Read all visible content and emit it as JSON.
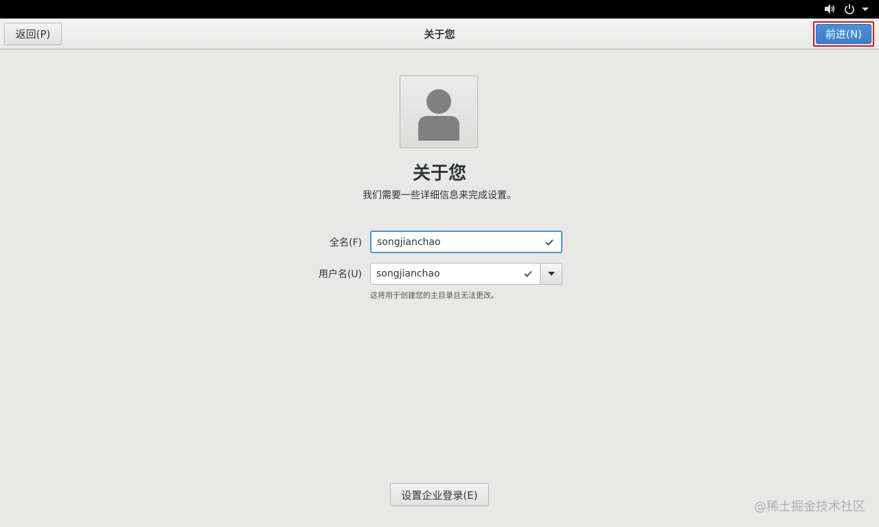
{
  "header": {
    "back_label": "返回(P)",
    "title": "关于您",
    "next_label": "前进(N)"
  },
  "main": {
    "title": "关于您",
    "subtitle": "我们需要一些详细信息来完成设置。",
    "fullname": {
      "label": "全名(F)",
      "value": "songjianchao"
    },
    "username": {
      "label": "用户名(U)",
      "value": "songjianchao",
      "hint": "这将用于创建您的主目录且无法更改。"
    },
    "enterprise_label": "设置企业登录(E)"
  },
  "watermark": "@稀土掘金技术社区",
  "colors": {
    "accent": "#4a90d9",
    "highlight": "#d6151f"
  },
  "icons": [
    "volume-icon",
    "power-icon",
    "chevron-down-icon",
    "avatar-icon",
    "check-icon"
  ]
}
